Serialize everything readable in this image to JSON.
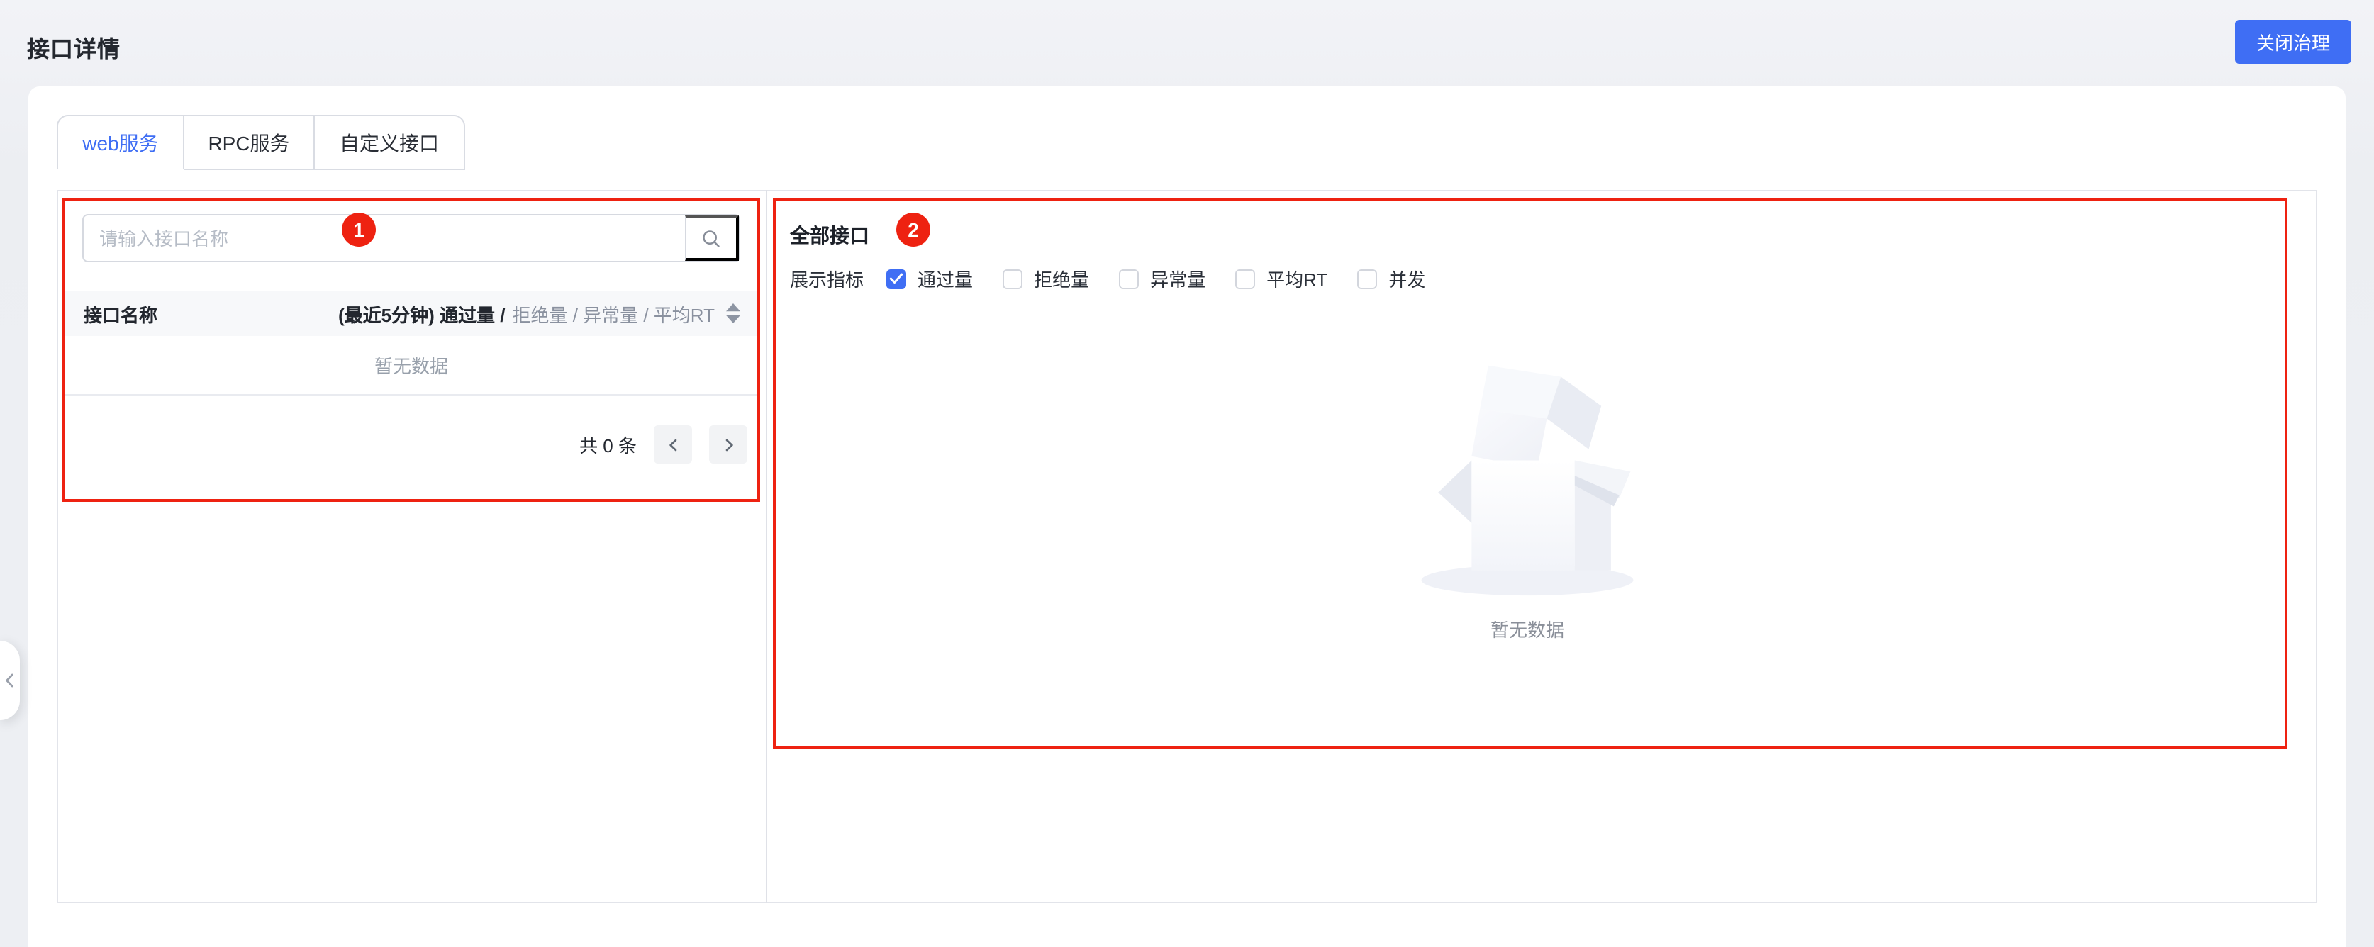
{
  "header": {
    "title": "接口详情",
    "close_button_label": "关闭治理"
  },
  "tabs": [
    {
      "label": "web服务",
      "active": true
    },
    {
      "label": "RPC服务",
      "active": false
    },
    {
      "label": "自定义接口",
      "active": false
    }
  ],
  "interface_list": {
    "search_placeholder": "请输入接口名称",
    "columns": {
      "name": "接口名称",
      "metrics_primary": "(最近5分钟) 通过量 /",
      "metrics_secondary": "拒绝量 / 异常量 / 平均RT"
    },
    "empty_text": "暂无数据",
    "pagination": {
      "total_text": "共 0 条"
    }
  },
  "metrics_panel": {
    "title": "全部接口",
    "filter_label": "展示指标",
    "metrics": [
      {
        "label": "通过量",
        "checked": true
      },
      {
        "label": "拒绝量",
        "checked": false
      },
      {
        "label": "异常量",
        "checked": false
      },
      {
        "label": "平均RT",
        "checked": false
      },
      {
        "label": "并发",
        "checked": false
      }
    ],
    "empty_text": "暂无数据"
  },
  "annotations": {
    "box1_label": "1",
    "box2_label": "2",
    "color": "#EE2211"
  },
  "colors": {
    "accent_blue": "#3F6EF4",
    "page_background": "#EDEFF3",
    "table_header_background": "#F7F8FA",
    "annotation_red": "#EE2211"
  }
}
